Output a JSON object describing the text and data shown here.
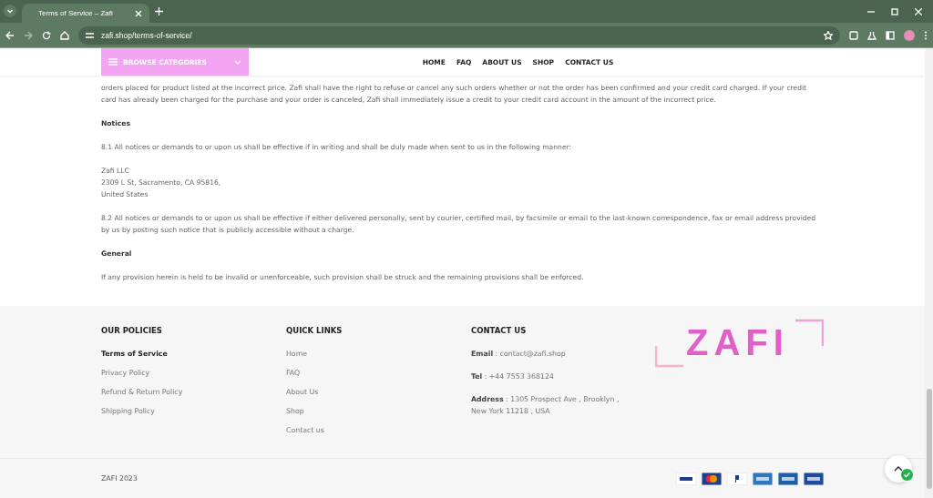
{
  "browser": {
    "tab_title": "Terms of Service – Zafi",
    "url": "zafi.shop/terms-of-service/"
  },
  "header": {
    "browse_label": "BROWSE CATEGORIES",
    "nav": [
      {
        "label": "HOME"
      },
      {
        "label": "FAQ"
      },
      {
        "label": "ABOUT US"
      },
      {
        "label": "SHOP"
      },
      {
        "label": "CONTACT US"
      }
    ]
  },
  "content": [
    {
      "kind": "paragraph",
      "lines": [
        "orders placed for product listed at the incorrect price. Zafi shall have the right to refuse or cancel any such orders whether or not the order has been confirmed and your credit card charged. If your credit card has already been charged for the purchase and your order is canceled, Zafi shall immediately issue a credit to your credit card account in the amount of the incorrect price."
      ]
    },
    {
      "kind": "heading",
      "lines": [
        "Notices"
      ]
    },
    {
      "kind": "paragraph",
      "lines": [
        "8.1 All notices or demands to or upon us shall be effective if in writing and shall be duly made when sent to us in the following manner:"
      ]
    },
    {
      "kind": "address",
      "lines": [
        "Zafi LLC",
        "2309 L St, Sacramento, CA 95816,",
        "United States"
      ]
    },
    {
      "kind": "paragraph",
      "lines": [
        "8.2 All notices or demands to or upon us shall be effective if either delivered personally, sent by courier, certified mail, by facsimile or email to the last-known correspondence, fax or email address provided by us by posting such notice that is publicly accessible without a charge."
      ]
    },
    {
      "kind": "heading",
      "lines": [
        "General"
      ]
    },
    {
      "kind": "paragraph",
      "lines": [
        "If any provision herein is held to be invalid or unenforceable, such provision shall be struck and the remaining provisions shall be enforced."
      ]
    }
  ],
  "footer": {
    "policies": {
      "title": "OUR POLICIES",
      "links": [
        {
          "label": "Terms of Service",
          "selected": true
        },
        {
          "label": "Privacy Policy",
          "selected": false
        },
        {
          "label": "Refund & Return Policy",
          "selected": false
        },
        {
          "label": "Shipping Policy",
          "selected": false
        }
      ]
    },
    "quick_links": {
      "title": "QUICK LINKS",
      "links": [
        "Home",
        "FAQ",
        "About Us",
        "Shop",
        "Contact us"
      ]
    },
    "contact": {
      "title": "CONTACT US",
      "items": [
        {
          "label": "Email",
          "value": ": contact@zafi.shop"
        },
        {
          "label": "Tel",
          "value": ": +44 7553 368124"
        },
        {
          "label": "Address",
          "value": ": 1305 Prospect Ave , Brooklyn , New York 11218 , USA"
        }
      ]
    },
    "logo": "ZAFI"
  },
  "bottom_bar": {
    "copyright": "ZAFI 2023"
  }
}
